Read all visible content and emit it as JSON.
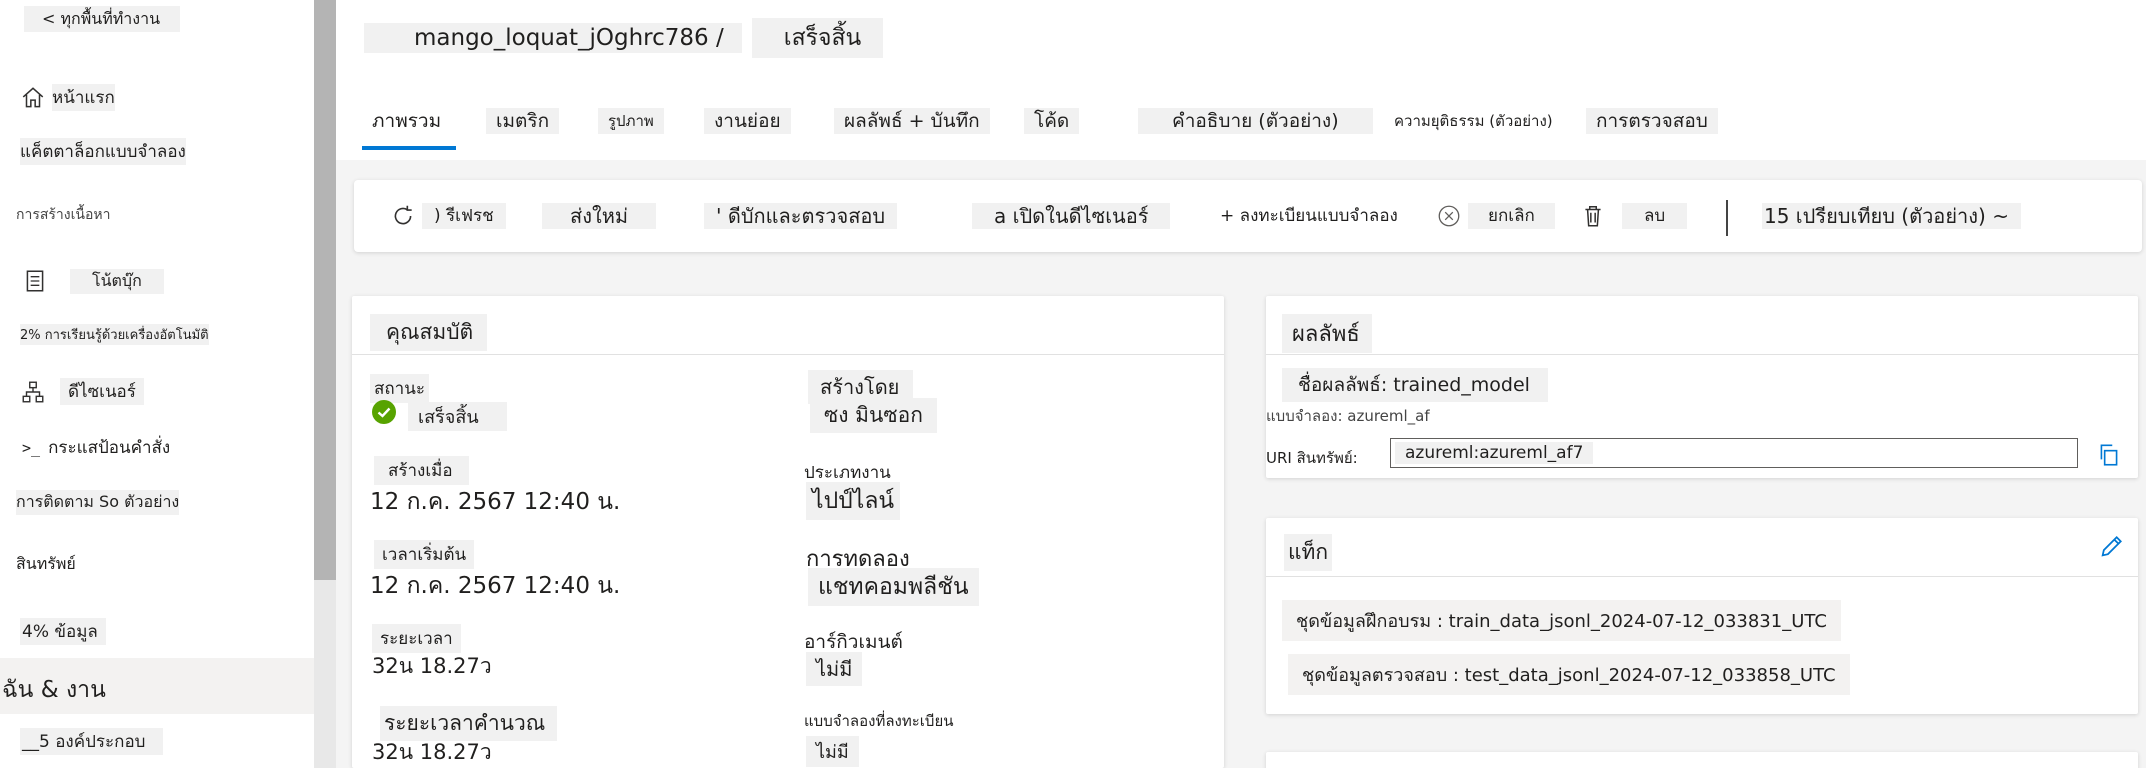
{
  "sidebar": {
    "back_label": "< ทุกพื้นที่ทำงาน",
    "home_label": "หน้าแรก",
    "model_catalog_label": "แค็ตตาล็อกแบบจำลอง",
    "authoring_label": "การสร้างเนื้อหา",
    "notebooks_label": "โน้ตบุ๊ก",
    "automl_label": "2% การเรียนรู้ด้วยเครื่องอัตโนมัติ",
    "designer_label": "ดีไซเนอร์",
    "prompt_flow_label": "กระแสป้อนคำสั่ง",
    "tracking_label": "การติดตาม So ตัวอย่าง",
    "assets_label": "สินทรัพย์",
    "data_label": "4% ข้อมูล",
    "jobs_label": "ฉัน & งาน",
    "components_label": "__5 องค์ประกอบ"
  },
  "header": {
    "job_name": "mango_loquat_jOghrc786 /",
    "status": "เสร็จสิ้น"
  },
  "tabs": [
    {
      "label": "ภาพรวม"
    },
    {
      "label": "เมตริก"
    },
    {
      "label": "รูปภาพ"
    },
    {
      "label": "งานย่อย"
    },
    {
      "label": "ผลลัพธ์ + บันทึก"
    },
    {
      "label": "โค้ด"
    },
    {
      "label": "คำอธิบาย (ตัวอย่าง)"
    },
    {
      "label": "ความยุติธรรม (ตัวอย่าง)"
    },
    {
      "label": "การตรวจสอบ"
    }
  ],
  "toolbar": {
    "refresh": ") รีเฟรช",
    "resubmit": "ส่งใหม่",
    "debug": "' ดีบักและตรวจสอบ",
    "open_designer": "a เปิดในดีไซเนอร์",
    "register_model": "+ ลงทะเบียนแบบจำลอง",
    "cancel": "ยกเลิก",
    "delete": "ลบ",
    "compare": "15 เปรียบเทียบ (ตัวอย่าง) ~"
  },
  "properties": {
    "title": "คุณสมบัติ",
    "status_label": "สถานะ",
    "status_value": "เสร็จสิ้น",
    "created_by_label": "สร้างโดย",
    "created_by_value": "ซง มินซอก",
    "created_on_label": "สร้างเมื่อ",
    "created_on_value": "12 ก.ค. 2567 12:40 น.",
    "job_type_label": "ประเภทงาน",
    "job_type_value": "ไปป์ไลน์",
    "start_time_label": "เวลาเริ่มต้น",
    "start_time_value": "12 ก.ค. 2567 12:40 น.",
    "experiment_label": "การทดลอง",
    "experiment_value": "แชทคอมพลีชัน",
    "duration_label": "ระยะเวลา",
    "duration_value": "32น 18.27ว",
    "arguments_label": "อาร์กิวเมนต์",
    "arguments_value": "ไม่มี",
    "compute_duration_label": "ระยะเวลาคำนวณ",
    "compute_duration_value": "32น 18.27ว",
    "registered_models_label": "แบบจำลองที่ลงทะเบียน",
    "registered_models_value": "ไม่มี"
  },
  "outputs": {
    "title": "ผลลัพธ์",
    "output_name": "ชื่อผลลัพธ์: trained_model",
    "model_line": "แบบจำลอง: azureml_af",
    "uri_label": "URI สินทรัพย์:",
    "uri_value": "azureml:azureml_af7"
  },
  "tags": {
    "title": "แท็ก",
    "train": "ชุดข้อมูลฝึกอบรม : train_data_jsonl_2024-07-12_033831_UTC",
    "test": "ชุดข้อมูลตรวจสอบ : test_data_jsonl_2024-07-12_033858_UTC"
  },
  "colors": {
    "accent": "#0078d4",
    "success": "#57a300"
  }
}
